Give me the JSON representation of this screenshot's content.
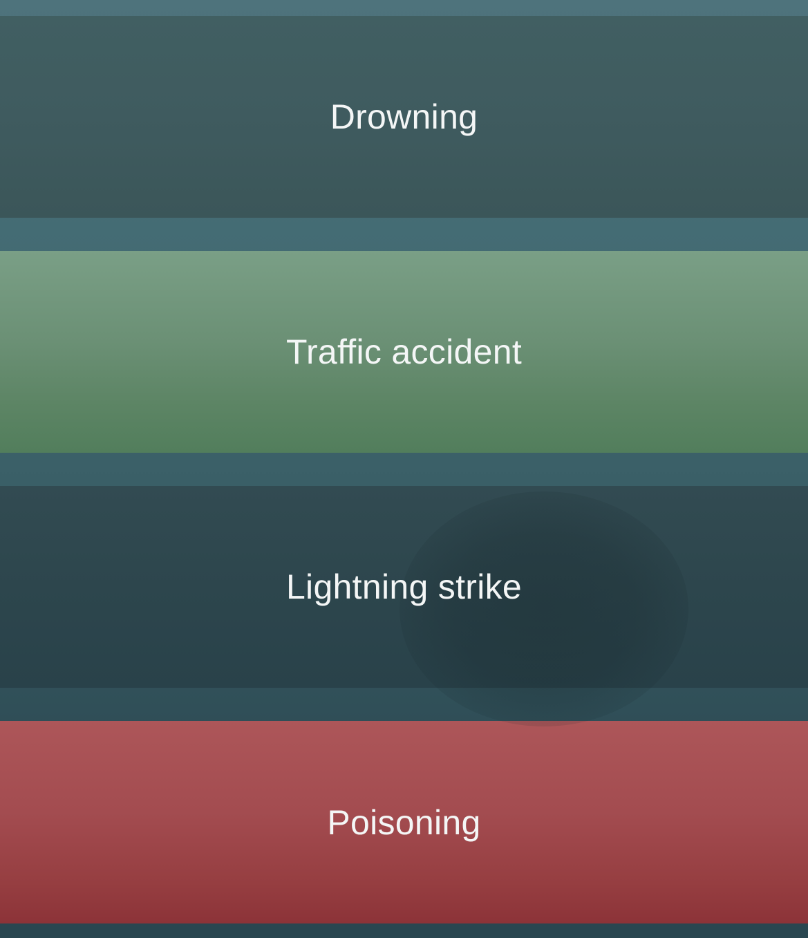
{
  "answers": [
    {
      "label": "Drowning",
      "state": "default",
      "color": "#3f5b5f"
    },
    {
      "label": "Traffic accident",
      "state": "correct",
      "color": "#6b9075"
    },
    {
      "label": "Lightning strike",
      "state": "pressed",
      "color": "#2d464d"
    },
    {
      "label": "Poisoning",
      "state": "wrong",
      "color": "#a34c50"
    }
  ],
  "colors": {
    "background": "#426a72",
    "text": "#f4f6f6",
    "correct": "#6b9075",
    "wrong": "#a34c50",
    "neutral": "#3f5b5f"
  }
}
